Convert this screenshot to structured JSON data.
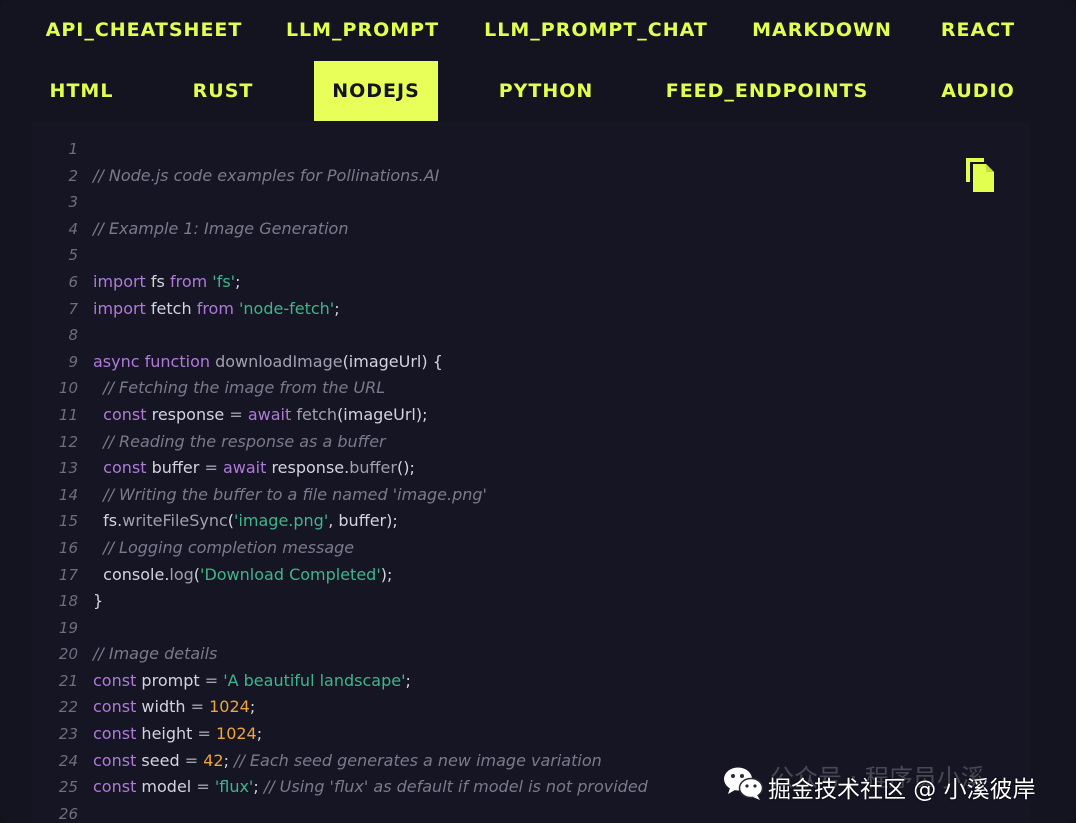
{
  "tabs": [
    {
      "label": "API_CHEATSHEET",
      "active": false
    },
    {
      "label": "LLM_PROMPT",
      "active": false
    },
    {
      "label": "LLM_PROMPT_CHAT",
      "active": false
    },
    {
      "label": "MARKDOWN",
      "active": false
    },
    {
      "label": "REACT",
      "active": false
    },
    {
      "label": "HTML",
      "active": false
    },
    {
      "label": "RUST",
      "active": false
    },
    {
      "label": "NODEJS",
      "active": true
    },
    {
      "label": "PYTHON",
      "active": false
    },
    {
      "label": "FEED_ENDPOINTS",
      "active": false
    },
    {
      "label": "AUDIO",
      "active": false
    }
  ],
  "code": {
    "lines": [
      {
        "n": "1",
        "tokens": []
      },
      {
        "n": "2",
        "tokens": [
          {
            "t": "// Node.js code examples for Pollinations.AI",
            "c": "cm"
          }
        ]
      },
      {
        "n": "3",
        "tokens": []
      },
      {
        "n": "4",
        "tokens": [
          {
            "t": "// Example 1: Image Generation",
            "c": "cm"
          }
        ]
      },
      {
        "n": "5",
        "tokens": []
      },
      {
        "n": "6",
        "tokens": [
          {
            "t": "import",
            "c": "kw"
          },
          {
            "t": " fs ",
            "c": "pl"
          },
          {
            "t": "from",
            "c": "kw"
          },
          {
            "t": " ",
            "c": "pl"
          },
          {
            "t": "'fs'",
            "c": "str"
          },
          {
            "t": ";",
            "c": "pl"
          }
        ]
      },
      {
        "n": "7",
        "tokens": [
          {
            "t": "import",
            "c": "kw"
          },
          {
            "t": " fetch ",
            "c": "pl"
          },
          {
            "t": "from",
            "c": "kw"
          },
          {
            "t": " ",
            "c": "pl"
          },
          {
            "t": "'node-fetch'",
            "c": "str"
          },
          {
            "t": ";",
            "c": "pl"
          }
        ]
      },
      {
        "n": "8",
        "tokens": []
      },
      {
        "n": "9",
        "tokens": [
          {
            "t": "async",
            "c": "kw"
          },
          {
            "t": " ",
            "c": "pl"
          },
          {
            "t": "function",
            "c": "kw"
          },
          {
            "t": " downloadImage",
            "c": "fn"
          },
          {
            "t": "(imageUrl) {",
            "c": "pl"
          }
        ]
      },
      {
        "n": "10",
        "tokens": [
          {
            "t": "  // Fetching the image from the URL",
            "c": "cm"
          }
        ]
      },
      {
        "n": "11",
        "tokens": [
          {
            "t": "  ",
            "c": "pl"
          },
          {
            "t": "const",
            "c": "kw"
          },
          {
            "t": " response ",
            "c": "pl"
          },
          {
            "t": "=",
            "c": "fn"
          },
          {
            "t": " ",
            "c": "pl"
          },
          {
            "t": "await",
            "c": "kw"
          },
          {
            "t": " fetch",
            "c": "fn"
          },
          {
            "t": "(imageUrl);",
            "c": "pl"
          }
        ]
      },
      {
        "n": "12",
        "tokens": [
          {
            "t": "  // Reading the response as a buffer",
            "c": "cm"
          }
        ]
      },
      {
        "n": "13",
        "tokens": [
          {
            "t": "  ",
            "c": "pl"
          },
          {
            "t": "const",
            "c": "kw"
          },
          {
            "t": " buffer ",
            "c": "pl"
          },
          {
            "t": "=",
            "c": "fn"
          },
          {
            "t": " ",
            "c": "pl"
          },
          {
            "t": "await",
            "c": "kw"
          },
          {
            "t": " response.",
            "c": "pl"
          },
          {
            "t": "buffer",
            "c": "fn"
          },
          {
            "t": "();",
            "c": "pl"
          }
        ]
      },
      {
        "n": "14",
        "tokens": [
          {
            "t": "  // Writing the buffer to a file named 'image.png'",
            "c": "cm"
          }
        ]
      },
      {
        "n": "15",
        "tokens": [
          {
            "t": "  fs.",
            "c": "pl"
          },
          {
            "t": "writeFileSync",
            "c": "fn"
          },
          {
            "t": "(",
            "c": "pl"
          },
          {
            "t": "'image.png'",
            "c": "str"
          },
          {
            "t": ", buffer);",
            "c": "pl"
          }
        ]
      },
      {
        "n": "16",
        "tokens": [
          {
            "t": "  // Logging completion message",
            "c": "cm"
          }
        ]
      },
      {
        "n": "17",
        "tokens": [
          {
            "t": "  console.",
            "c": "pl"
          },
          {
            "t": "log",
            "c": "fn"
          },
          {
            "t": "(",
            "c": "pl"
          },
          {
            "t": "'Download Completed'",
            "c": "str"
          },
          {
            "t": ");",
            "c": "pl"
          }
        ]
      },
      {
        "n": "18",
        "tokens": [
          {
            "t": "}",
            "c": "pl"
          }
        ]
      },
      {
        "n": "19",
        "tokens": []
      },
      {
        "n": "20",
        "tokens": [
          {
            "t": "// Image details",
            "c": "cm"
          }
        ]
      },
      {
        "n": "21",
        "tokens": [
          {
            "t": "const",
            "c": "kw"
          },
          {
            "t": " prompt ",
            "c": "pl"
          },
          {
            "t": "=",
            "c": "fn"
          },
          {
            "t": " ",
            "c": "pl"
          },
          {
            "t": "'A beautiful landscape'",
            "c": "str"
          },
          {
            "t": ";",
            "c": "pl"
          }
        ]
      },
      {
        "n": "22",
        "tokens": [
          {
            "t": "const",
            "c": "kw"
          },
          {
            "t": " width ",
            "c": "pl"
          },
          {
            "t": "=",
            "c": "fn"
          },
          {
            "t": " ",
            "c": "pl"
          },
          {
            "t": "1024",
            "c": "num"
          },
          {
            "t": ";",
            "c": "pl"
          }
        ]
      },
      {
        "n": "23",
        "tokens": [
          {
            "t": "const",
            "c": "kw"
          },
          {
            "t": " height ",
            "c": "pl"
          },
          {
            "t": "=",
            "c": "fn"
          },
          {
            "t": " ",
            "c": "pl"
          },
          {
            "t": "1024",
            "c": "num"
          },
          {
            "t": ";",
            "c": "pl"
          }
        ]
      },
      {
        "n": "24",
        "tokens": [
          {
            "t": "const",
            "c": "kw"
          },
          {
            "t": " seed ",
            "c": "pl"
          },
          {
            "t": "=",
            "c": "fn"
          },
          {
            "t": " ",
            "c": "pl"
          },
          {
            "t": "42",
            "c": "num"
          },
          {
            "t": "; ",
            "c": "pl"
          },
          {
            "t": "// Each seed generates a new image variation",
            "c": "cm"
          }
        ]
      },
      {
        "n": "25",
        "tokens": [
          {
            "t": "const",
            "c": "kw"
          },
          {
            "t": " model ",
            "c": "pl"
          },
          {
            "t": "=",
            "c": "fn"
          },
          {
            "t": " ",
            "c": "pl"
          },
          {
            "t": "'flux'",
            "c": "str"
          },
          {
            "t": "; ",
            "c": "pl"
          },
          {
            "t": "// Using 'flux' as default if model is not provided",
            "c": "cm"
          }
        ]
      },
      {
        "n": "26",
        "tokens": []
      }
    ]
  },
  "copy_button": {
    "icon": "copy-icon",
    "color": "#e2ff4f"
  },
  "watermark": {
    "faded_text": "公众号 · 程序员小溪",
    "text": "掘金技术社区 @ 小溪彼岸",
    "icon": "wechat-icon"
  },
  "colors": {
    "background": "#141421",
    "code_background": "#151524",
    "accent": "#e2ff4f",
    "active_tab_bg": "#e8ff5a",
    "keyword": "#b07ad8",
    "string": "#3fb58a",
    "number": "#f0a43a",
    "comment": "#7a7a8c"
  }
}
